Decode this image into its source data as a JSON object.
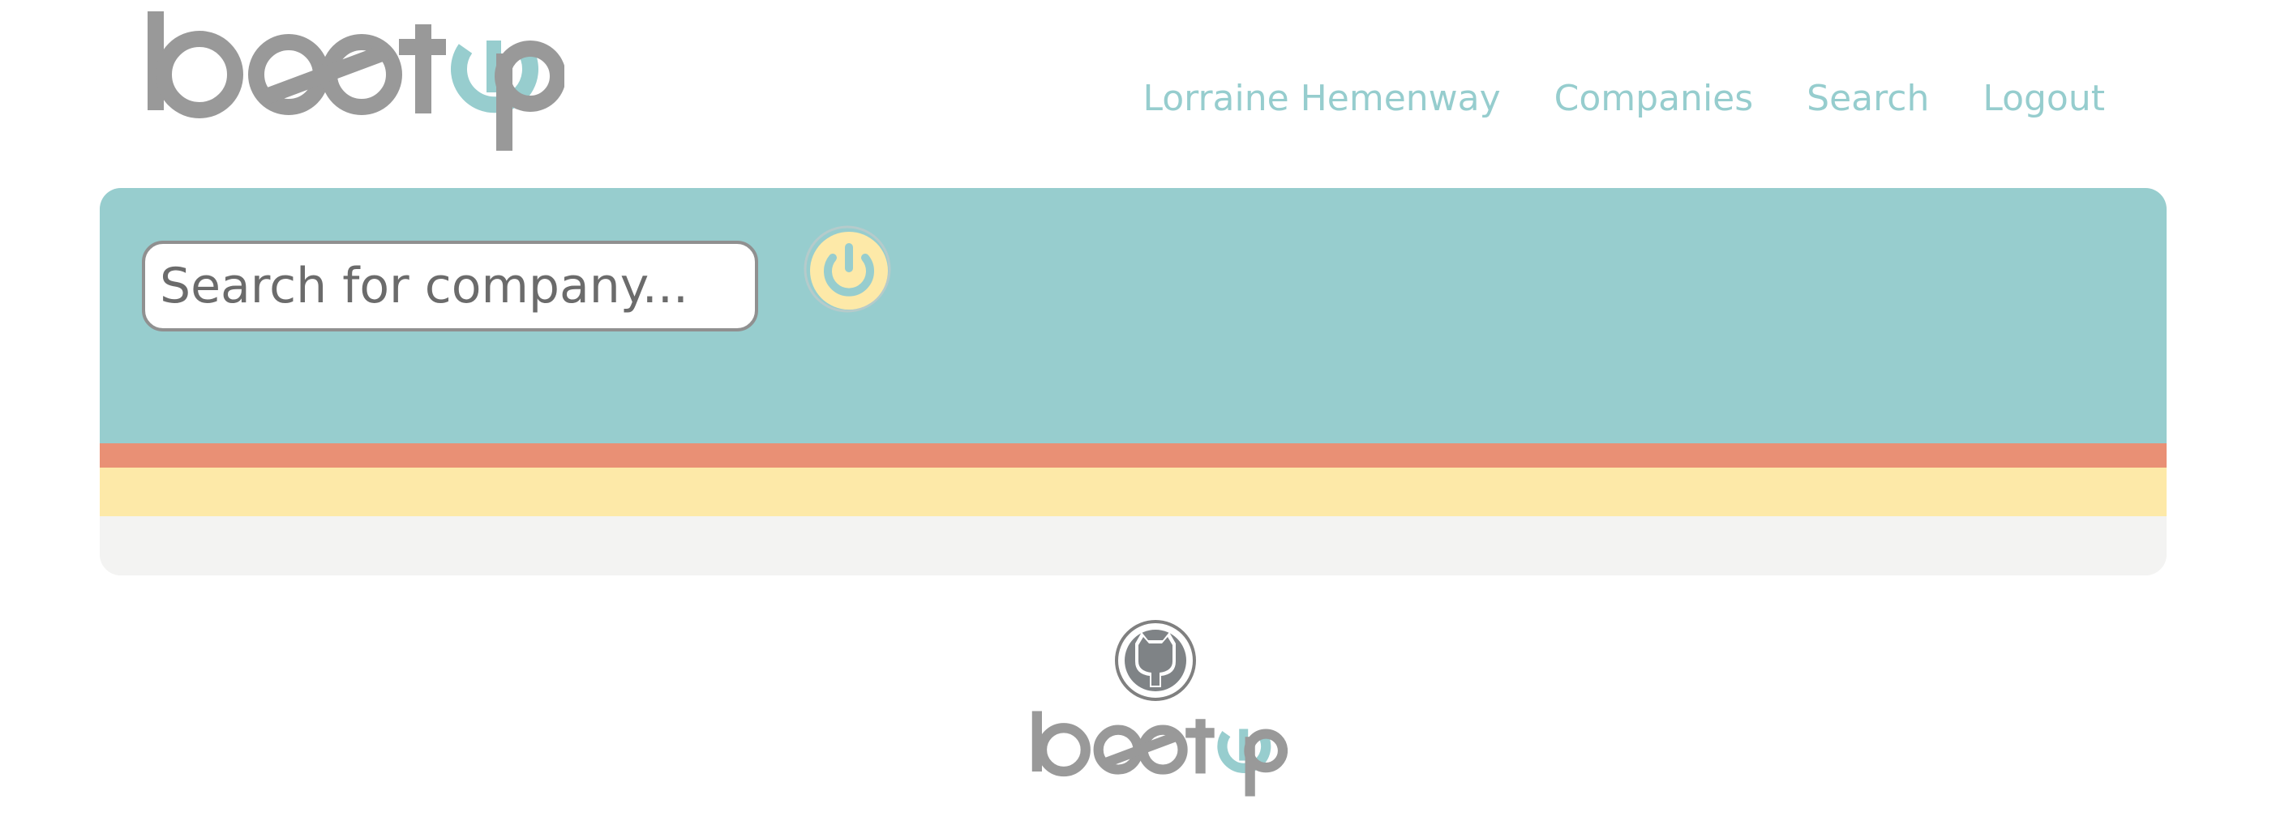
{
  "header": {
    "logo_text": "bootup",
    "nav": [
      {
        "label": "Lorraine Hemenway"
      },
      {
        "label": "Companies"
      },
      {
        "label": "Search"
      },
      {
        "label": "Logout"
      }
    ]
  },
  "search": {
    "placeholder": "Search for company...",
    "value": "",
    "submit_icon": "power-icon"
  },
  "footer": {
    "icon": "github-icon",
    "logo_text": "bootup"
  },
  "colors": {
    "teal": "#97cdce",
    "orange": "#e99075",
    "yellow": "#fde9a8",
    "light_gray": "#f3f3f2",
    "logo_gray": "#999999",
    "nav_text": "#96cdce"
  }
}
